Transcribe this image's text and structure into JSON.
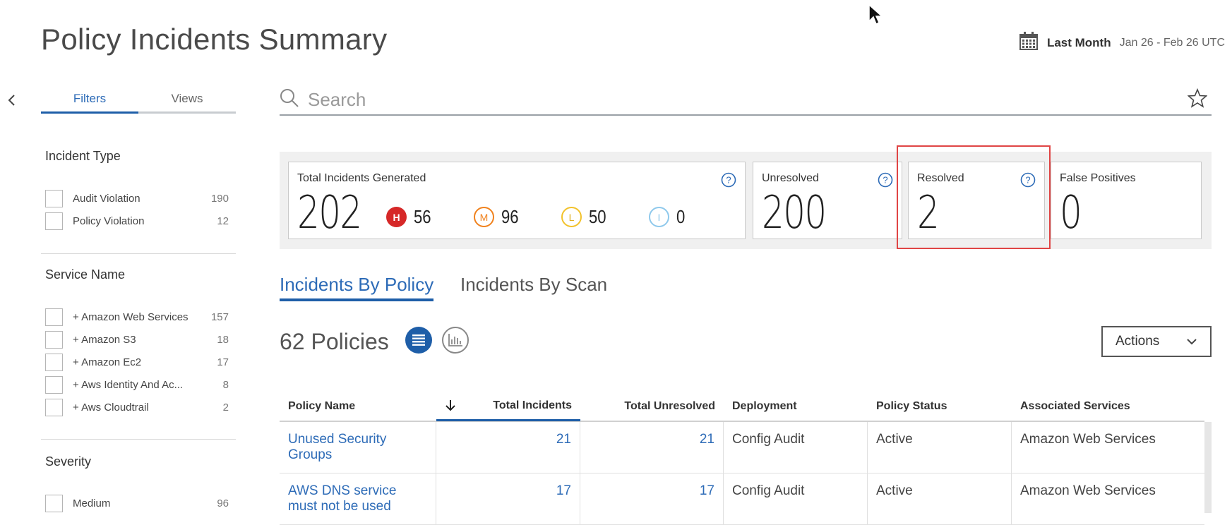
{
  "header": {
    "title": "Policy Incidents Summary",
    "date_label": "Last Month",
    "date_range": "Jan 26 - Feb 26 UTC"
  },
  "sidebar": {
    "tabs": [
      {
        "label": "Filters",
        "active": true
      },
      {
        "label": "Views",
        "active": false
      }
    ],
    "sections": [
      {
        "title": "Incident Type",
        "items": [
          {
            "label": "Audit Violation",
            "count": "190"
          },
          {
            "label": "Policy Violation",
            "count": "12"
          }
        ]
      },
      {
        "title": "Service Name",
        "items": [
          {
            "label": "+ Amazon Web Services",
            "count": "157"
          },
          {
            "label": "+ Amazon S3",
            "count": "18"
          },
          {
            "label": "+ Amazon Ec2",
            "count": "17"
          },
          {
            "label": "+ Aws Identity And Ac...",
            "count": "8"
          },
          {
            "label": "+ Aws Cloudtrail",
            "count": "2"
          }
        ]
      },
      {
        "title": "Severity",
        "items": [
          {
            "label": "Medium",
            "count": "96"
          }
        ]
      }
    ]
  },
  "search": {
    "placeholder": "Search"
  },
  "stats": {
    "total": {
      "title": "Total Incidents Generated",
      "value": "202",
      "severities": [
        {
          "letter": "H",
          "count": "56",
          "color": "#d62828"
        },
        {
          "letter": "M",
          "count": "96",
          "color": "#f0821e"
        },
        {
          "letter": "L",
          "count": "50",
          "color": "#f2c22b"
        },
        {
          "letter": "I",
          "count": "0",
          "color": "#8fc9ec"
        }
      ]
    },
    "unresolved": {
      "title": "Unresolved",
      "value": "200"
    },
    "resolved": {
      "title": "Resolved",
      "value": "2"
    },
    "false_positives": {
      "title": "False Positives",
      "value": "0"
    }
  },
  "tabs": [
    {
      "label": "Incidents By Policy",
      "active": true
    },
    {
      "label": "Incidents By Scan",
      "active": false
    }
  ],
  "policies": {
    "count_label": "62 Policies",
    "actions_label": "Actions"
  },
  "table": {
    "columns": [
      "Policy Name",
      "Total Incidents",
      "Total Unresolved",
      "Deployment",
      "Policy Status",
      "Associated Services"
    ],
    "rows": [
      {
        "name": "Unused Security Groups",
        "total": "21",
        "unresolved": "21",
        "deployment": "Config Audit",
        "status": "Active",
        "services": "Amazon Web Services"
      },
      {
        "name": "AWS DNS service must not be used",
        "total": "17",
        "unresolved": "17",
        "deployment": "Config Audit",
        "status": "Active",
        "services": "Amazon Web Services"
      }
    ]
  },
  "colors": {
    "accent": "#1e5ea8",
    "link": "#2d6bb7",
    "highlight": "#e04545"
  }
}
